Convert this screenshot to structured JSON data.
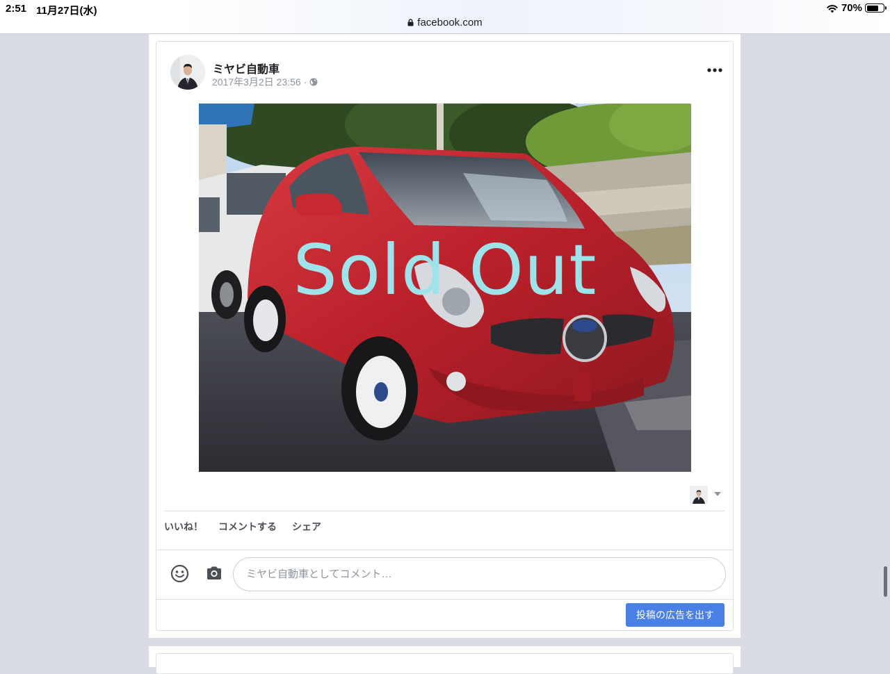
{
  "status_bar": {
    "time": "2:51",
    "date": "11月27日(水)",
    "battery": "70%",
    "battery_level": 0.7,
    "url": "facebook.com"
  },
  "post": {
    "author": "ミヤビ自動車",
    "timestamp": "2017年3月2日 23:56",
    "separator": "·",
    "image_overlay_text": "Sold Out",
    "actions": {
      "like": "いいね！",
      "comment": "コメントする",
      "share": "シェア"
    },
    "comment_placeholder": "ミヤビ自動車としてコメント…",
    "boost_button": "投稿の広告を出す"
  },
  "colors": {
    "accent": "#4a80e6",
    "overlay_text": "#9fe3ea",
    "car": "#c8252b"
  },
  "icons": [
    "lock-icon",
    "wifi-icon",
    "battery-icon",
    "globe-icon",
    "more-options-icon",
    "chevron-down-icon",
    "smiley-icon",
    "camera-icon"
  ]
}
